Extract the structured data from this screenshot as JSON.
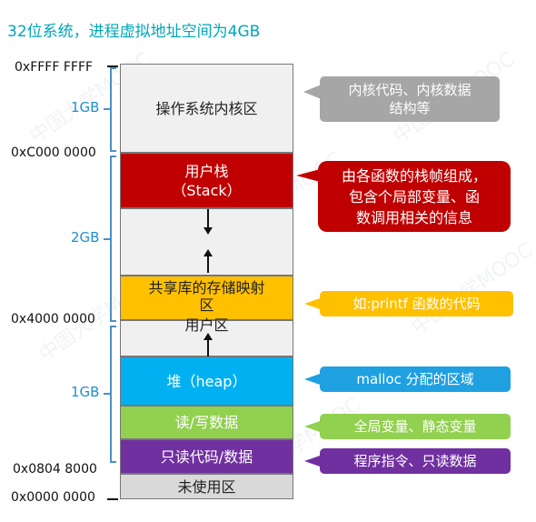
{
  "title": "32位系统，进程虚拟地址空间为4GB",
  "addresses": {
    "top": "0xFFFF FFFF",
    "kernel_start": "0xC000 0000",
    "shared_lib": "0x4000 0000",
    "text_start": "0x0804 8000",
    "bottom": "0x0000 0000"
  },
  "sizes": {
    "kernel": "1GB",
    "upper_user": "2GB",
    "lower_user": "1GB"
  },
  "segments": {
    "kernel": "操作系统内核区",
    "stack_line1": "用户栈",
    "stack_line2": "（Stack）",
    "shared_line1": "共享库的存储映射",
    "shared_line2": "区",
    "user_area": "用户区",
    "heap": "堆（heap）",
    "rw_data": "读/写数据",
    "ro_code": "只读代码/数据",
    "unused": "未使用区"
  },
  "callouts": {
    "kernel_line1": "内核代码、内核数据",
    "kernel_line2": "结构等",
    "stack_line1": "由各函数的栈帧组成，",
    "stack_line2": "包含个局部变量、函",
    "stack_line3": "数调用相关的信息",
    "shared": "如:printf 函数的代码",
    "heap": "malloc 分配的区域",
    "rw_data": "全局变量、静态变量",
    "ro_code": "程序指令、只读数据"
  },
  "watermark": "中国大学MOOC",
  "colors": {
    "title": "#00a6b8",
    "gray_segment": "#f0f0f0",
    "stack": "#c00000",
    "shared_lib": "#ffc000",
    "heap": "#00b0f0",
    "rw_data": "#92d050",
    "ro_code": "#7030a0",
    "unused": "#d9d9d9",
    "brace": "#4a90c8",
    "callout_gray": "#a6a6a6",
    "callout_red": "#c00000",
    "callout_orange": "#ffc000",
    "callout_blue": "#1fa0e0",
    "callout_green": "#92d050",
    "callout_purple": "#7030a0"
  }
}
